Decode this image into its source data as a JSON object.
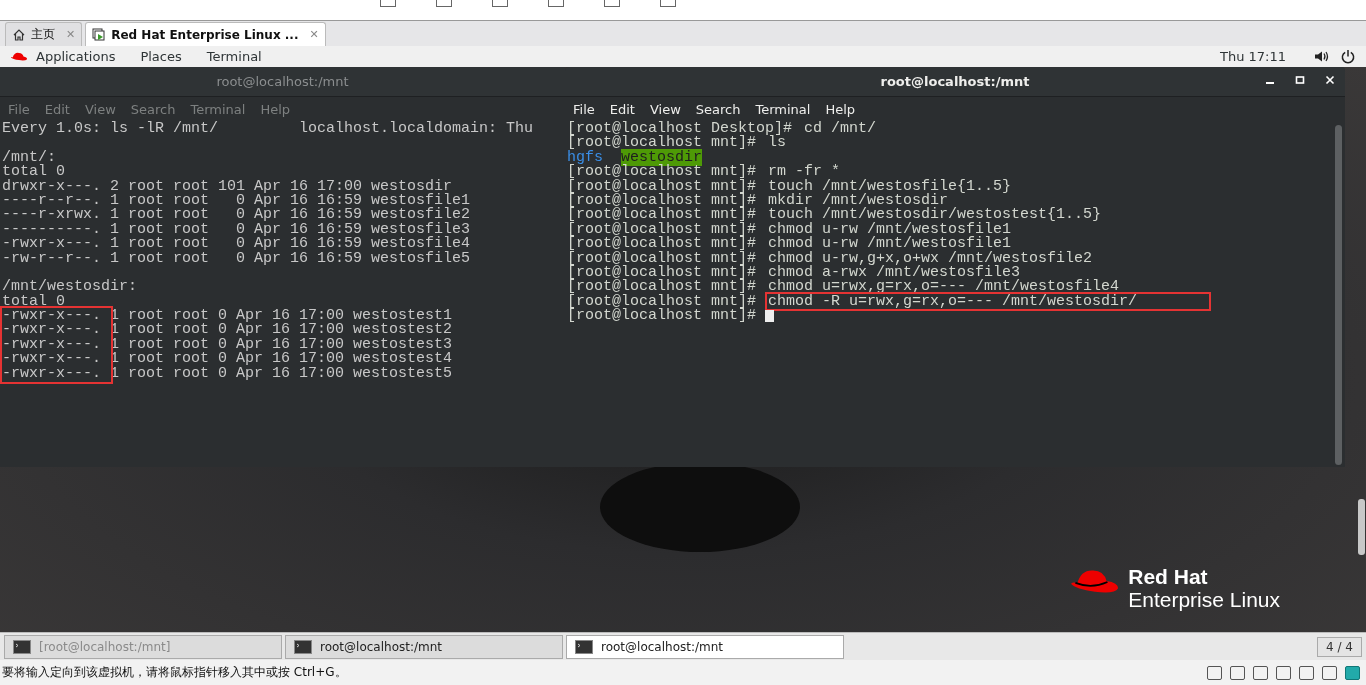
{
  "browser_tabs": [
    {
      "label": "主页",
      "close": "✕",
      "selected": false
    },
    {
      "label": "Red Hat Enterprise Linux ...",
      "close": "✕",
      "selected": true
    }
  ],
  "top_bar": {
    "menus": [
      "Applications",
      "Places",
      "Terminal"
    ],
    "clock": "Thu 17:11"
  },
  "terminals": [
    {
      "title": "root@localhost:/mnt",
      "active": false,
      "menu": [
        "File",
        "Edit",
        "View",
        "Search",
        "Terminal",
        "Help"
      ],
      "blocks": [
        [
          {
            "text": "Every 1.0s: ls -lR /mnt/         localhost.localdomain: Thu",
            "marked": false
          }
        ],
        [
          {
            "text": "/mnt/:",
            "marked": false
          },
          {
            "text": "total 0",
            "marked": false
          },
          {
            "text": "drwxr-x---. 2 root root 101 Apr 16 17:00 westosdir",
            "marked": false
          },
          {
            "text": "----r--r--. 1 root root   0 Apr 16 16:59 westosfile1",
            "marked": false
          },
          {
            "text": "----r-xrwx. 1 root root   0 Apr 16 16:59 westosfile2",
            "marked": false
          },
          {
            "text": "----------. 1 root root   0 Apr 16 16:59 westosfile3",
            "marked": false
          },
          {
            "text": "-rwxr-x---. 1 root root   0 Apr 16 16:59 westosfile4",
            "marked": false
          },
          {
            "text": "-rw-r--r--. 1 root root   0 Apr 16 16:59 westosfile5",
            "marked": false
          }
        ],
        [
          {
            "text": "/mnt/westosdir:",
            "marked": false
          },
          {
            "text": "total 0",
            "marked": false
          },
          {
            "text": "-rwxr-x---. 1 root root 0 Apr 16 17:00 westostest1",
            "marked": true
          },
          {
            "text": "-rwxr-x---. 1 root root 0 Apr 16 17:00 westostest2",
            "marked": true
          },
          {
            "text": "-rwxr-x---. 1 root root 0 Apr 16 17:00 westostest3",
            "marked": true
          },
          {
            "text": "-rwxr-x---. 1 root root 0 Apr 16 17:00 westostest4",
            "marked": true
          },
          {
            "text": "-rwxr-x---. 1 root root 0 Apr 16 17:00 westostest5",
            "marked": true
          }
        ]
      ]
    },
    {
      "title": "root@localhost:/mnt",
      "active": true,
      "menu": [
        "File",
        "Edit",
        "View",
        "Search",
        "Terminal",
        "Help"
      ],
      "blocks": [
        [
          {
            "prompt": "[root@localhost Desktop]#",
            "command": "cd /mnt/",
            "marked": false
          },
          {
            "prompt": "[root@localhost mnt]#",
            "command": "ls",
            "marked": false
          },
          {
            "entries": [
              {
                "name": "hgfs",
                "kind": "link"
              },
              {
                "name": "westosdir",
                "kind": "sticky_dir"
              }
            ]
          },
          {
            "prompt": "[root@localhost mnt]#",
            "command": "rm -fr *",
            "marked": false
          },
          {
            "prompt": "[root@localhost mnt]#",
            "command": "touch /mnt/westosfile{1..5}",
            "marked": false
          },
          {
            "prompt": "[root@localhost mnt]#",
            "command": "mkdir /mnt/westosdir",
            "marked": false
          },
          {
            "prompt": "[root@localhost mnt]#",
            "command": "touch /mnt/westosdir/westostest{1..5}",
            "marked": false
          },
          {
            "prompt": "[root@localhost mnt]#",
            "command": "chmod u-rw /mnt/westosfile1",
            "marked": false
          },
          {
            "prompt": "[root@localhost mnt]#",
            "command": "chmod u-rw /mnt/westosfile1",
            "marked": false
          },
          {
            "prompt": "[root@localhost mnt]#",
            "command": "chmod u-rw,g+x,o+wx /mnt/westosfile2",
            "marked": false
          },
          {
            "prompt": "[root@localhost mnt]#",
            "command": "chmod a-rwx /mnt/westosfile3",
            "marked": false
          },
          {
            "prompt": "[root@localhost mnt]#",
            "command": "chmod u=rwx,g=rx,o=--- /mnt/westosfile4",
            "marked": false
          },
          {
            "prompt": "[root@localhost mnt]#",
            "command": "chmod -R u=rwx,g=rx,o=--- /mnt/westosdir/",
            "marked": true
          },
          {
            "prompt": "[root@localhost mnt]#",
            "cursor": true
          }
        ]
      ]
    }
  ],
  "logo": {
    "line1": "Red Hat",
    "line2": "Enterprise Linux"
  },
  "taskbar": {
    "items": [
      {
        "label": "[root@localhost:/mnt]",
        "minimized": true,
        "selected": false
      },
      {
        "label": "root@localhost:/mnt",
        "minimized": false,
        "selected": false
      },
      {
        "label": "root@localhost:/mnt",
        "minimized": false,
        "selected": true
      }
    ],
    "pager": "4 / 4"
  },
  "status_bar": {
    "message": "要将输入定向到该虚拟机，请将鼠标指针移入其中或按 Ctrl+G。"
  }
}
